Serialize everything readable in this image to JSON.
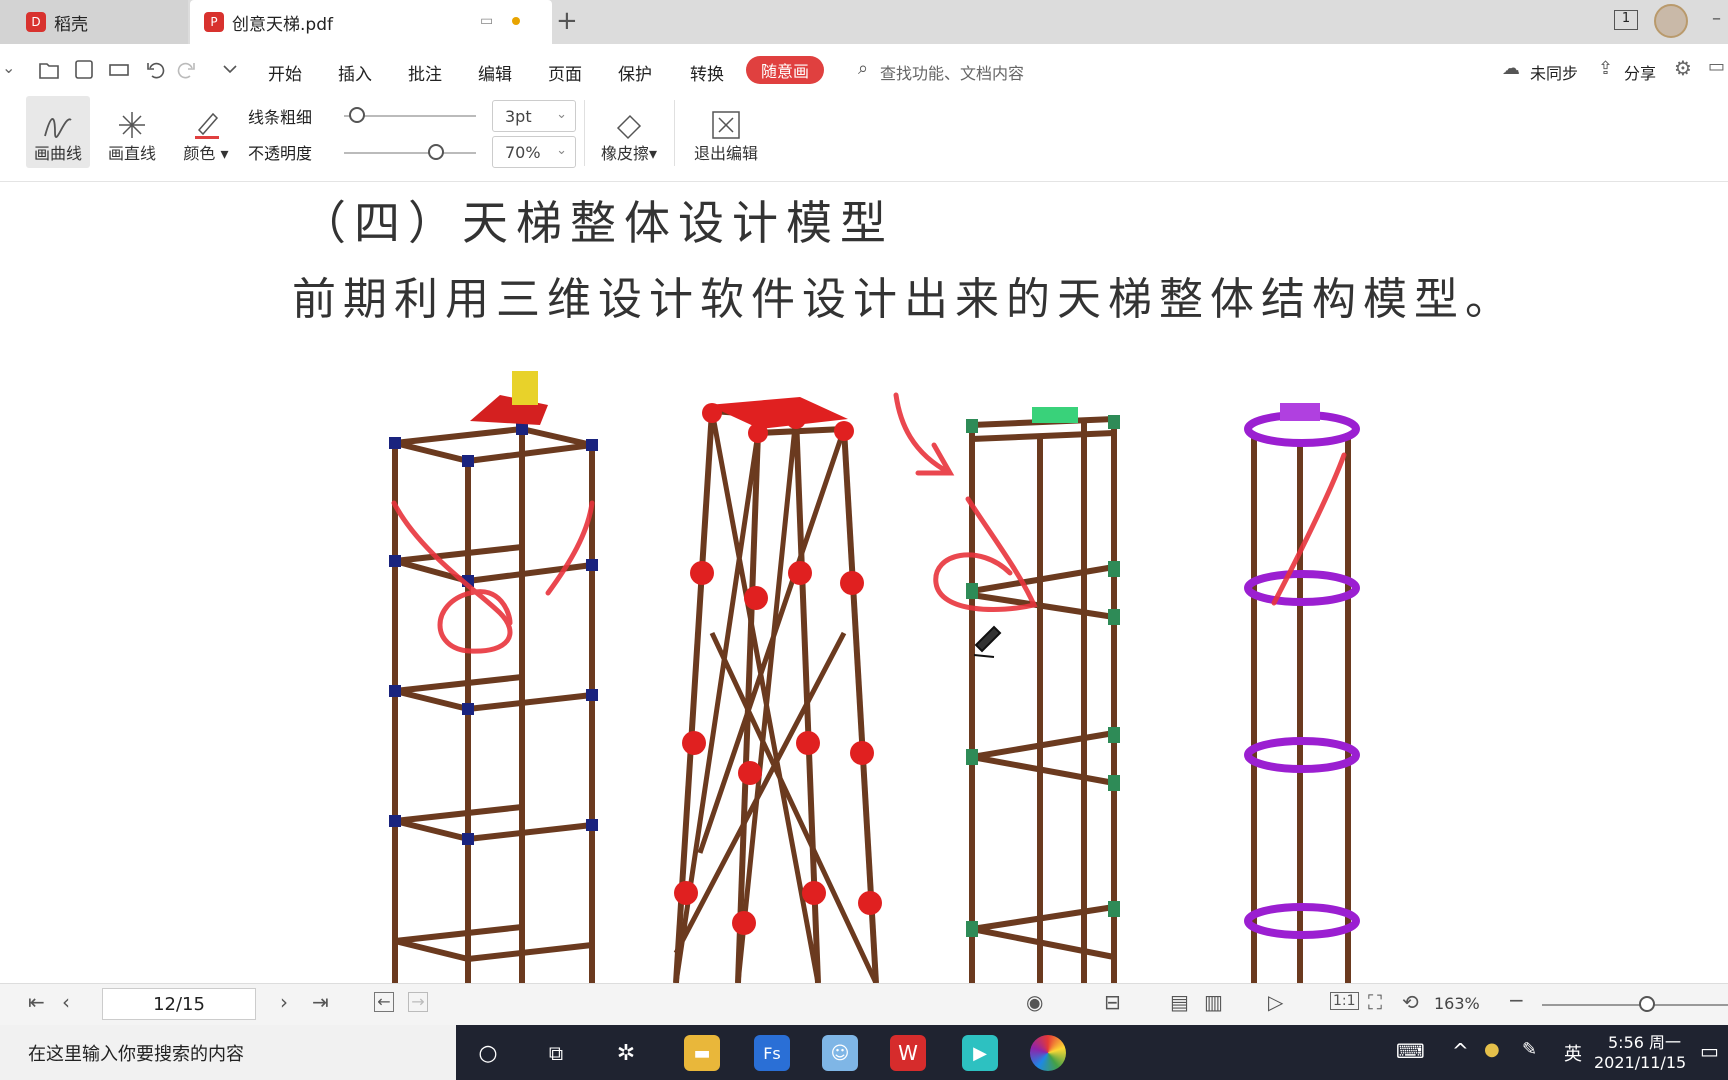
{
  "tabs": [
    {
      "label": "稻壳",
      "icon": "docer-logo-icon"
    },
    {
      "label": "创意天梯.pdf",
      "icon": "pdf-file-icon"
    }
  ],
  "tab_add": "+",
  "page_count_badge": "1",
  "menu": {
    "items": [
      "开始",
      "插入",
      "批注",
      "编辑",
      "页面",
      "保护",
      "转换"
    ],
    "active": "随意画",
    "search_placeholder": "查找功能、文档内容",
    "sync_label": "未同步",
    "share_label": "分享"
  },
  "drawbar": {
    "curve_label": "画曲线",
    "line_label": "画直线",
    "color_label": "颜色",
    "thickness_label": "线条粗细",
    "thickness_value": "3pt",
    "opacity_label": "不透明度",
    "opacity_value": "70%",
    "thickness_level": 0.1,
    "opacity_level": 0.7,
    "eraser_label": "橡皮擦",
    "exit_label": "退出编辑",
    "pen_color": "#e0403f"
  },
  "document": {
    "heading": "（四）天梯整体设计模型",
    "paragraph": "前期利用三维设计软件设计出来的天梯整体结构模型。"
  },
  "bottombar": {
    "page_indicator": "12/15",
    "zoom": "163%",
    "zoom_level": 0.7
  },
  "taskbar": {
    "search_placeholder": "在这里输入你要搜索的内容",
    "ime": "英",
    "time": "5:56 周一",
    "date": "2021/11/15"
  },
  "colors": {
    "tower1_joint": "#1a237e",
    "tower2_joint": "#e02020",
    "tower3_joint": "#2e8b57",
    "tower4_ring": "#9b1fd1",
    "beam": "#6b3a1f",
    "annotation": "#e8343c"
  }
}
